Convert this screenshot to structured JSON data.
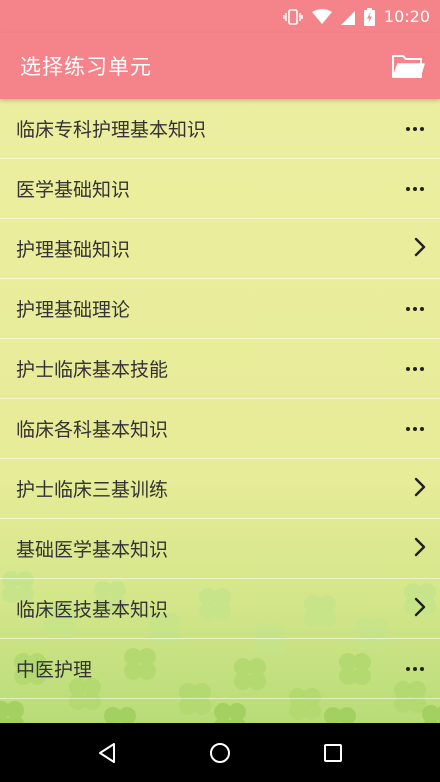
{
  "status_bar": {
    "time": "10:20"
  },
  "app_bar": {
    "title": "选择练习单元"
  },
  "units": [
    {
      "label": "临床专科护理基本知识",
      "action": "more"
    },
    {
      "label": "医学基础知识",
      "action": "more"
    },
    {
      "label": "护理基础知识",
      "action": "chevron"
    },
    {
      "label": "护理基础理论",
      "action": "more"
    },
    {
      "label": "护士临床基本技能",
      "action": "more"
    },
    {
      "label": "临床各科基本知识",
      "action": "more"
    },
    {
      "label": "护士临床三基训练",
      "action": "chevron"
    },
    {
      "label": "基础医学基本知识",
      "action": "chevron"
    },
    {
      "label": "临床医技基本知识",
      "action": "chevron"
    },
    {
      "label": "中医护理",
      "action": "more"
    }
  ],
  "colors": {
    "accent": "#f48489",
    "list_bg": "#ebee9f"
  }
}
